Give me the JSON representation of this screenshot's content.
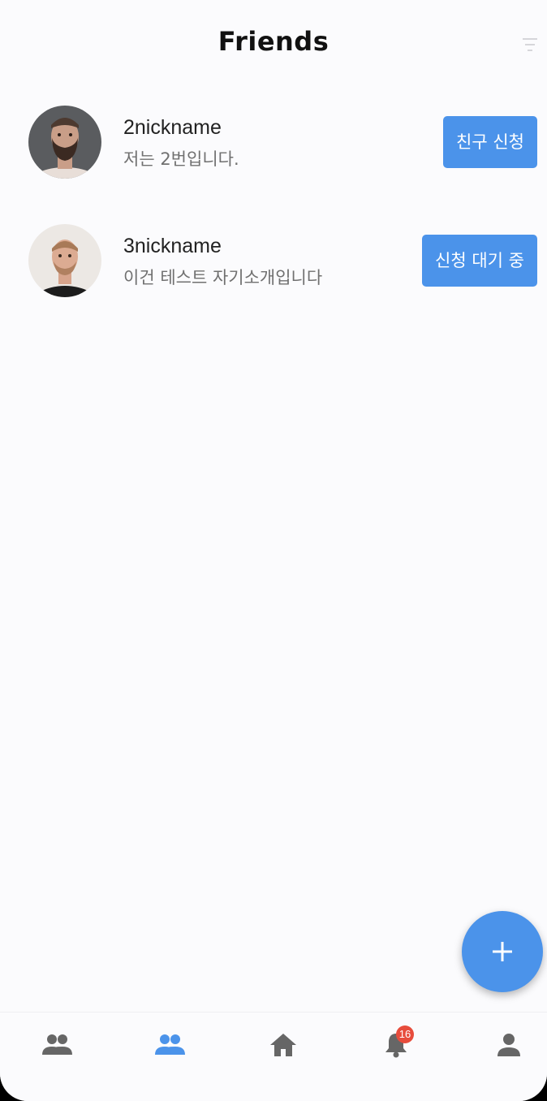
{
  "header": {
    "title": "Friends"
  },
  "friends": [
    {
      "nickname": "2nickname",
      "bio": "저는 2번입니다.",
      "action_label": "친구 신청",
      "avatar_icon": "bearded-man-avatar"
    },
    {
      "nickname": "3nickname",
      "bio": "이건 테스트 자기소개입니다",
      "action_label": "신청 대기 중",
      "avatar_icon": "man-avatar"
    }
  ],
  "fab": {
    "icon": "plus-icon"
  },
  "bottom_nav": {
    "items": [
      {
        "icon": "people-icon",
        "active": false
      },
      {
        "icon": "people-icon",
        "active": true
      },
      {
        "icon": "home-icon",
        "active": false
      },
      {
        "icon": "bell-icon",
        "active": false,
        "badge": "16"
      },
      {
        "icon": "person-icon",
        "active": false
      }
    ]
  },
  "colors": {
    "accent": "#4b93ea",
    "icon_inactive": "#666666",
    "badge": "#e74c3c",
    "background": "#fbfbfd"
  }
}
